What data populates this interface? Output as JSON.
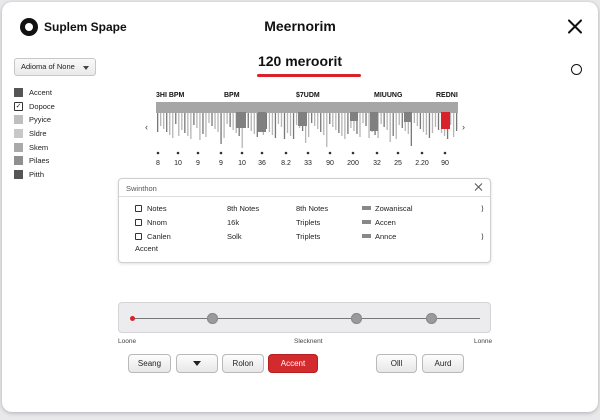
{
  "brand": {
    "name": "Suplem Spape"
  },
  "window": {
    "title": "Meernorim"
  },
  "headline": "120 meroorit",
  "dropdown": {
    "value": "Adioma of None"
  },
  "legend": [
    {
      "label": "Accent",
      "color": "#555555",
      "type": "swatch"
    },
    {
      "label": "Dopoce",
      "color": "#ffffff",
      "type": "check"
    },
    {
      "label": "Pyyice",
      "color": "#bfbfbf",
      "type": "swatch"
    },
    {
      "label": "Sldre",
      "color": "#c8c8c8",
      "type": "swatch"
    },
    {
      "label": "Skem",
      "color": "#a9a9a9",
      "type": "swatch"
    },
    {
      "label": "Pilaes",
      "color": "#8f8f8f",
      "type": "swatch"
    },
    {
      "label": "Pitth",
      "color": "#555555",
      "type": "swatch"
    }
  ],
  "chart_data": {
    "type": "bar",
    "group_labels": [
      "3HI BPM",
      "BPM",
      "$7UDM",
      "MIUUNG",
      "REDNI"
    ],
    "tick_labels": [
      "8",
      "10",
      "9",
      "9",
      "10",
      "36",
      "8.2",
      "33",
      "90",
      "200",
      "32",
      "25",
      "2.20",
      "90"
    ],
    "nav": {
      "left": "‹",
      "right": "›"
    },
    "highlight_color": "#d8232a"
  },
  "panel": {
    "title": "Swinthon",
    "rows": [
      {
        "c1": "Notes",
        "c2": "8th Notes",
        "c3": "8th Notes",
        "c4": "Zowaniscal",
        "c5": "⟩"
      },
      {
        "c1": "Nnom",
        "c2": "16k",
        "c3": "Triplets",
        "c4": "Accen",
        "c5": ""
      },
      {
        "c1": "Canlen",
        "c2": "Solk",
        "c3": "Triplets",
        "c4": "Annce",
        "c5": "⟩"
      }
    ],
    "footer": "Accent"
  },
  "slider": {
    "left_label": "Loone",
    "middle_label": "Slecknent",
    "right_label": "Lonne"
  },
  "buttons": {
    "b1": "Seang",
    "b3": "Rolon",
    "b4": "Accent",
    "b5": "Olll",
    "b6": "Aurd"
  },
  "colors": {
    "accent": "#d8232a"
  }
}
